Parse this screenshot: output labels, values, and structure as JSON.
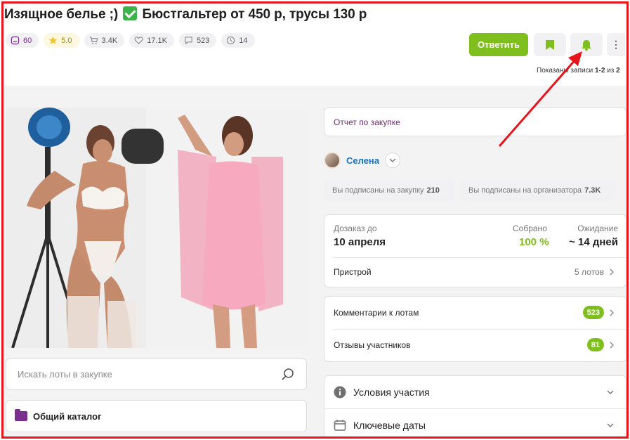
{
  "title": "Изящное белье ;) ✅ Бюстгальтер от 450 р, трусы 130 р",
  "title_parts": {
    "before": "Изящное белье ;)",
    "after": "Бюстгальтер от 450 р, трусы 130 р"
  },
  "stats": [
    {
      "icon": "heart-face-icon",
      "value": "60"
    },
    {
      "icon": "star-icon",
      "value": "5.0"
    },
    {
      "icon": "cart-icon",
      "value": "3.4K"
    },
    {
      "icon": "heart-icon",
      "value": "17.1K"
    },
    {
      "icon": "comment-icon",
      "value": "523"
    },
    {
      "icon": "clock-icon",
      "value": "14"
    }
  ],
  "buttons": {
    "reply": "Ответить",
    "more": "⋮"
  },
  "shown_text": {
    "prefix": "Показаны записи",
    "range": "1-2",
    "mid": "из",
    "total": "2"
  },
  "search": {
    "placeholder": "Искать лоты в закупке"
  },
  "catalog": {
    "label": "Общий каталог"
  },
  "report": {
    "label": "Отчет по закупке"
  },
  "organizer": {
    "name": "Селена"
  },
  "subscriptions": [
    {
      "label": "Вы подписаны на закупку",
      "value": "210"
    },
    {
      "label": "Вы подписаны на организатора",
      "value": "7.3K"
    }
  ],
  "info": {
    "dozakaz": {
      "label": "Дозаказ до",
      "value": "10 апреля"
    },
    "collected": {
      "label": "Собрано",
      "value": "100 %"
    },
    "waiting": {
      "label": "Ожидание",
      "value": "~ 14 дней"
    },
    "pristroy": {
      "label": "Пристрой",
      "value": "5 лотов"
    }
  },
  "comments": [
    {
      "label": "Комментарии к лотам",
      "count": "523"
    },
    {
      "label": "Отзывы участников",
      "count": "81"
    }
  ],
  "accordion": [
    {
      "icon": "info-icon",
      "label": "Условия участия"
    },
    {
      "icon": "calendar-icon",
      "label": "Ключевые даты"
    }
  ],
  "colors": {
    "accent_green": "#7fbf1d",
    "purple": "#7a2f8f",
    "link_blue": "#1a73c2",
    "annotation_red": "#e8141b"
  }
}
